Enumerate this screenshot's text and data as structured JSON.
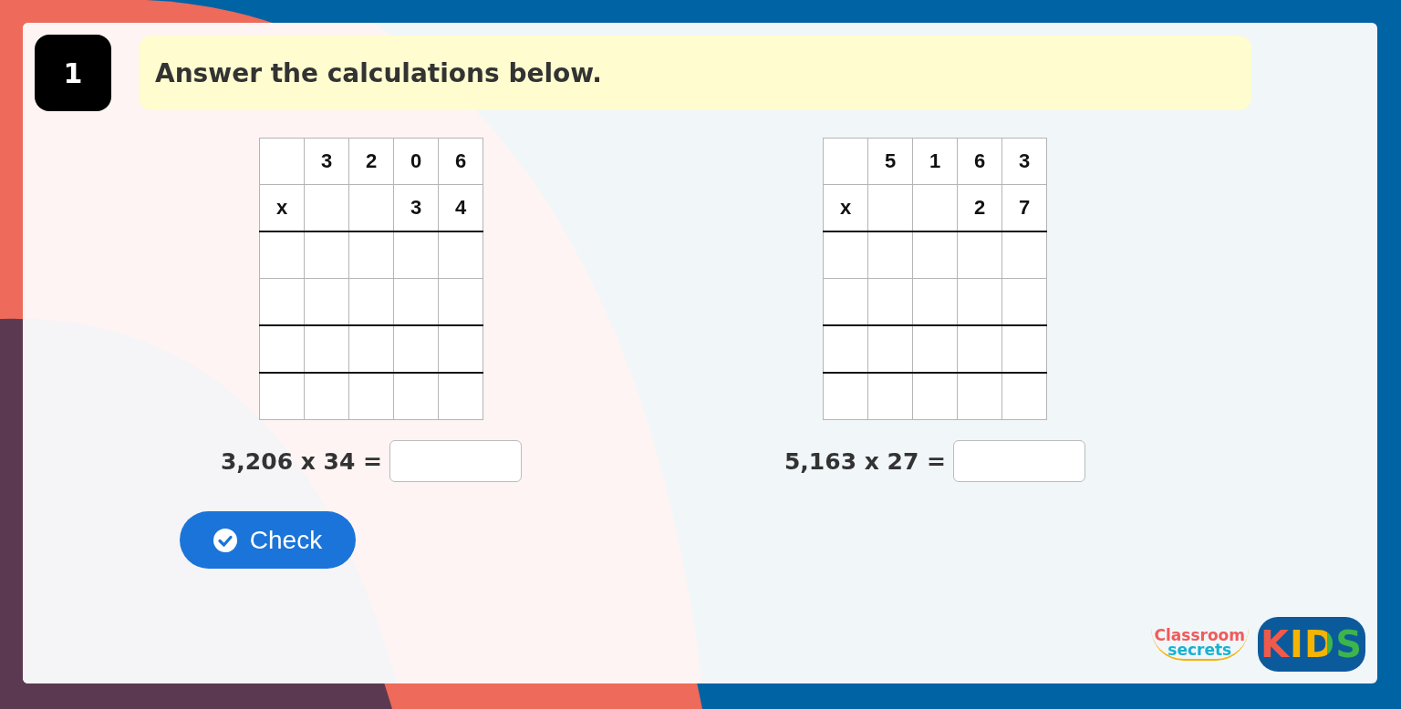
{
  "question": {
    "number": "1",
    "prompt": "Answer the calculations below."
  },
  "problems": [
    {
      "top_digits": [
        "3",
        "2",
        "0",
        "6"
      ],
      "operator": "x",
      "multiplier_digits": [
        "3",
        "4"
      ],
      "equation": "3,206 x 34 ="
    },
    {
      "top_digits": [
        "5",
        "1",
        "6",
        "3"
      ],
      "operator": "x",
      "multiplier_digits": [
        "2",
        "7"
      ],
      "equation": "5,163 x 27 ="
    }
  ],
  "check_button": {
    "label": "Check"
  },
  "logo": {
    "brand_top": "Classroom",
    "brand_bottom": "secrets",
    "badge": "KIDS"
  }
}
